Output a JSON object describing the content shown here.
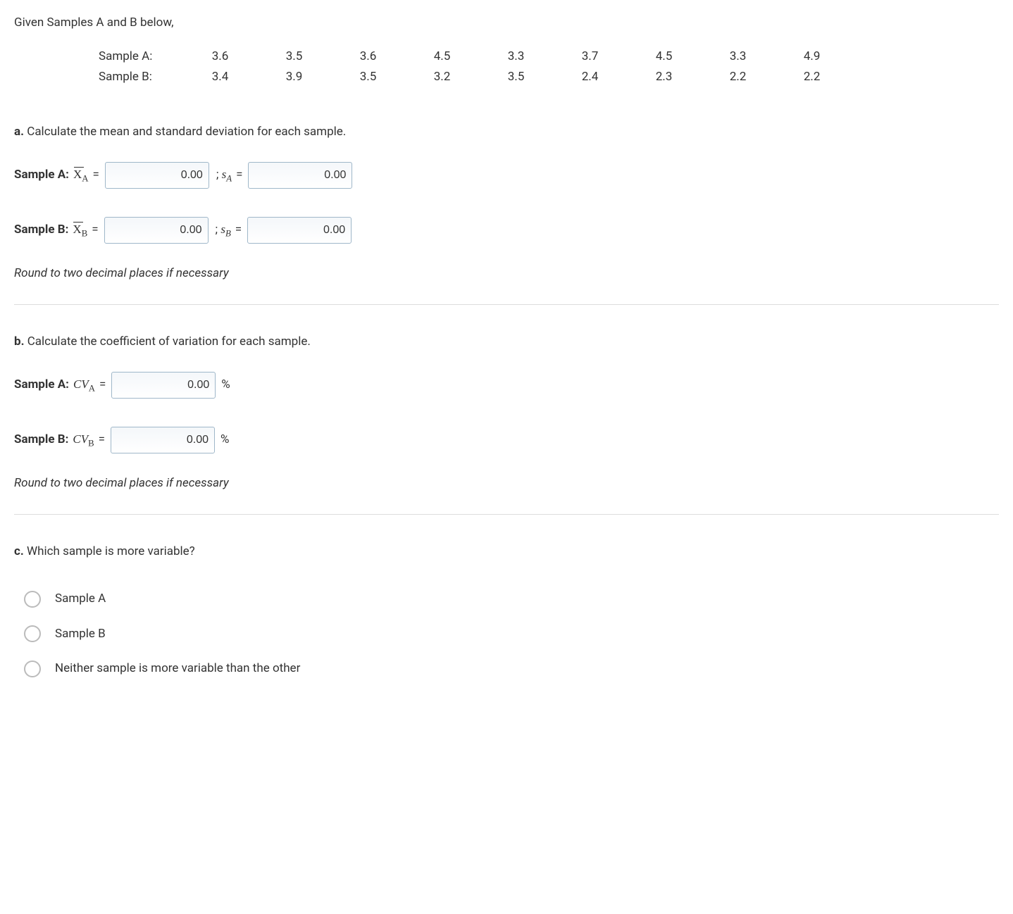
{
  "intro": "Given Samples A and B below,",
  "samples": {
    "a_label": "Sample A:",
    "b_label": "Sample B:",
    "a": [
      "3.6",
      "3.5",
      "3.6",
      "4.5",
      "3.3",
      "3.7",
      "4.5",
      "3.3",
      "4.9"
    ],
    "b": [
      "3.4",
      "3.9",
      "3.5",
      "3.2",
      "3.5",
      "2.4",
      "2.3",
      "2.2",
      "2.2"
    ]
  },
  "partA": {
    "title_bold": "a.",
    "title_rest": " Calculate the mean and standard deviation for each sample.",
    "rowA_lead": "Sample A:",
    "rowA_sym1": "x̄",
    "rowA_sub1": "A",
    "rowA_sym2": "s",
    "rowA_sub2": "A",
    "rowB_lead": "Sample B:",
    "rowB_sym1": "x̄",
    "rowB_sub1": "B",
    "rowB_sym2": "s",
    "rowB_sub2": "B",
    "sep": ";",
    "eq": "=",
    "val": "0.00",
    "note": "Round to two decimal places if necessary"
  },
  "partB": {
    "title_bold": "b.",
    "title_rest": " Calculate the coefficient of variation for each sample.",
    "rowA_lead": "Sample A:",
    "rowA_sym": "CV",
    "rowA_sub": "A",
    "rowB_lead": "Sample B:",
    "rowB_sym": "CV",
    "rowB_sub": "B",
    "eq": "=",
    "val": "0.00",
    "pct": "%",
    "note": "Round to two decimal places if necessary"
  },
  "partC": {
    "title_bold": "c.",
    "title_rest": " Which sample is more variable?",
    "opt1": "Sample A",
    "opt2": "Sample B",
    "opt3": "Neither sample is more variable than the other"
  }
}
